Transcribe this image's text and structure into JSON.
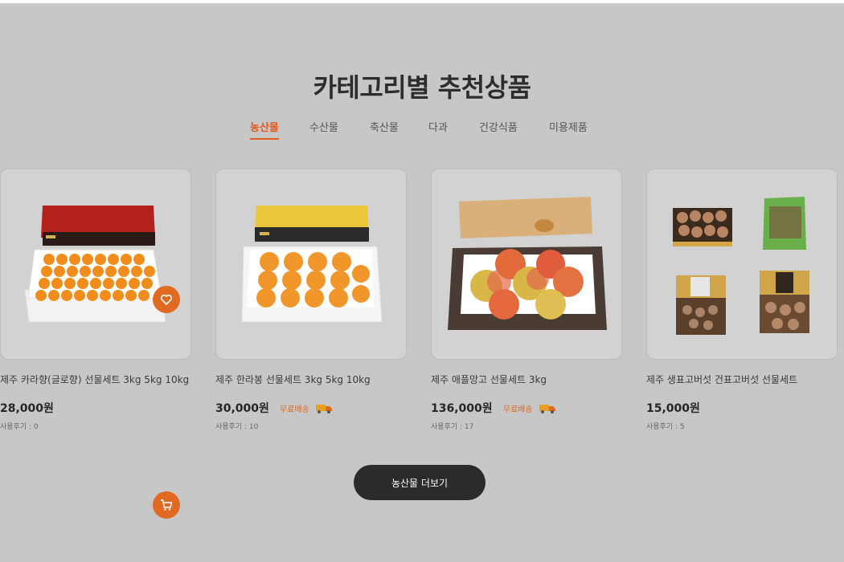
{
  "section": {
    "title": "카테고리별 추천상품"
  },
  "tabs": [
    {
      "label": "농산물",
      "active": true
    },
    {
      "label": "수산물",
      "active": false
    },
    {
      "label": "축산물",
      "active": false
    },
    {
      "label": "다과",
      "active": false
    },
    {
      "label": "건강식품",
      "active": false
    },
    {
      "label": "미용제품",
      "active": false
    }
  ],
  "products": [
    {
      "name": "제주 카라향(글로향) 선물세트 3kg 5kg 10kg",
      "price": "28,000원",
      "free_shipping": "",
      "review_label": "사용후기 : 0"
    },
    {
      "name": "제주 한라봉 선물세트 3kg 5kg 10kg",
      "price": "30,000원",
      "free_shipping": "무료배송",
      "review_label": "사용후기 : 10"
    },
    {
      "name": "제주 애플망고 선물세트 3kg",
      "price": "136,000원",
      "free_shipping": "무료배송",
      "review_label": "사용후기 : 17"
    },
    {
      "name": "제주 생표고버섯 건표고버섯 선물세트",
      "price": "15,000원",
      "free_shipping": "",
      "review_label": "사용후기 : 5"
    }
  ],
  "icons": {
    "wishlist": "heart-icon",
    "cart": "cart-icon",
    "shipping": "truck-icon"
  },
  "more_button": {
    "label": "농산물 더보기"
  },
  "colors": {
    "accent": "#e25a1e",
    "button_dark": "#2b2b2b",
    "background": "#c7c7c7"
  }
}
